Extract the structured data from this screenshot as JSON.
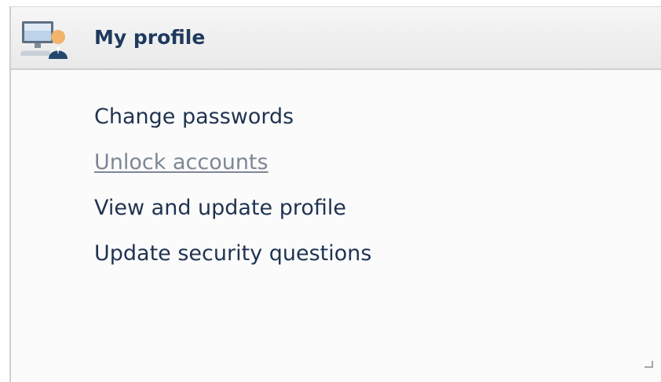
{
  "panel": {
    "title": "My profile",
    "icon": "computer-user-icon",
    "links": [
      {
        "label": "Change passwords",
        "visited": false
      },
      {
        "label": "Unlock accounts",
        "visited": true
      },
      {
        "label": "View and update profile",
        "visited": false
      },
      {
        "label": "Update security questions",
        "visited": false
      }
    ]
  },
  "colors": {
    "title": "#1f3a5f",
    "link": "#1f3350",
    "link_visited": "#7d8796",
    "header_bg": "#eeeeee",
    "panel_bg": "#fbfbfb"
  }
}
